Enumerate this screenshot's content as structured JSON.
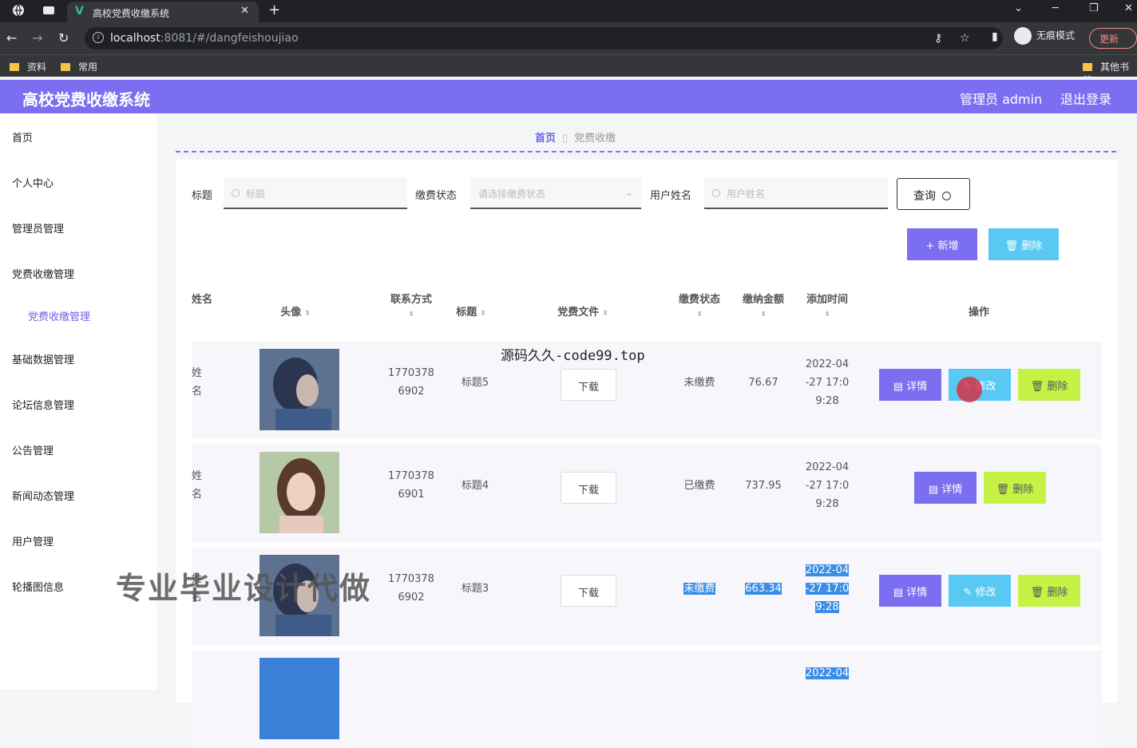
{
  "browser": {
    "tab_title": "高校党费收缴系统",
    "url_host": "localhost",
    "url_path": ":8081/#/dangfeishoujiao",
    "incognito_label": "无痕模式",
    "update_label": "更新",
    "bookmarks": [
      "资料",
      "常用",
      "其他书签"
    ]
  },
  "header": {
    "app_title": "高校党费收缴系统",
    "admin_label": "管理员 admin",
    "logout_label": "退出登录"
  },
  "sidebar": {
    "items": [
      "首页",
      "个人中心",
      "管理员管理",
      "党费收缴管理",
      "党费收缴管理",
      "基础数据管理",
      "论坛信息管理",
      "公告管理",
      "新闻动态管理",
      "用户管理",
      "轮播图信息"
    ]
  },
  "breadcrumb": {
    "home": "首页",
    "current": "党费收缴"
  },
  "filters": {
    "title_label": "标题",
    "title_placeholder": "标题",
    "status_label": "缴费状态",
    "status_placeholder": "请选择缴费状态",
    "user_label": "用户姓名",
    "user_placeholder": "用户姓名",
    "query_label": "查询"
  },
  "actions": {
    "add_label": "新增",
    "delete_label": "删除"
  },
  "table": {
    "headers": [
      "姓名",
      "头像",
      "联系方式",
      "标题",
      "党费文件",
      "缴费状态",
      "缴纳金额",
      "添加时间",
      "操作"
    ],
    "rows": [
      {
        "name": "姓名",
        "phone1": "1770378",
        "phone2": "6902",
        "title": "标题5",
        "file": "下载",
        "status": "未缴费",
        "amount": "76.67",
        "time1": "2022-04",
        "time2": "-27 17:0",
        "time3": "9:28"
      },
      {
        "name": "姓名",
        "phone1": "1770378",
        "phone2": "6901",
        "title": "标题4",
        "file": "下载",
        "status": "已缴费",
        "amount": "737.95",
        "time1": "2022-04",
        "time2": "-27 17:0",
        "time3": "9:28"
      },
      {
        "name": "姓名",
        "phone1": "1770378",
        "phone2": "6902",
        "title": "标题3",
        "file": "下载",
        "status": "未缴费",
        "amount": "663.34",
        "time1": "2022-04",
        "time2": "-27 17:0",
        "time3": "9:28"
      },
      {
        "time1": "2022-04"
      }
    ],
    "op_detail": "详情",
    "op_edit": "修改",
    "op_delete": "删除"
  },
  "watermarks": {
    "overlay_top": "源码久久-code99.top",
    "overlay_big": "专业毕业设计代做"
  },
  "colors": {
    "primary": "#7b6ef0",
    "info": "#58c9f3",
    "lime": "#c6f246"
  }
}
